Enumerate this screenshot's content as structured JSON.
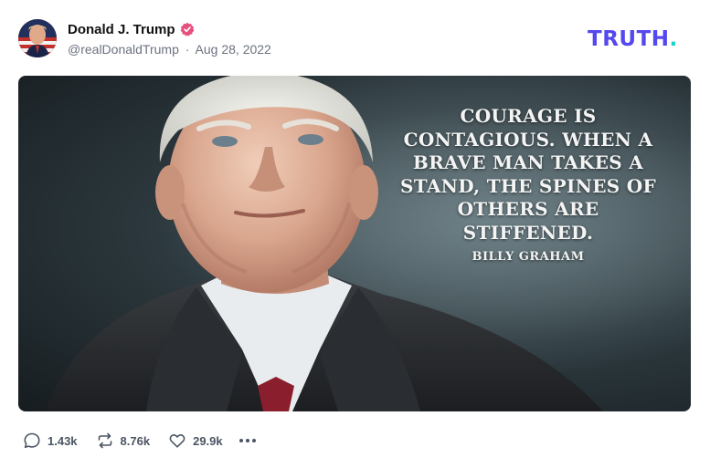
{
  "post": {
    "author_name": "Donald J. Trump",
    "handle": "@realDonaldTrump",
    "separator": "·",
    "date": "Aug 28, 2022",
    "verified_icon": "verified-badge-icon",
    "brand_logo": "TRUTH",
    "brand_period": ".",
    "media": {
      "quote_lines": [
        "Courage is",
        "contagious. When a",
        "brave man takes a",
        "stand, the spines of",
        "others are",
        "stiffened."
      ],
      "attribution": "Billy Graham"
    },
    "actions": {
      "replies": "1.43k",
      "retruths": "8.76k",
      "likes": "29.9k",
      "more_icon": "more-dots-icon"
    }
  },
  "colors": {
    "brand": "#5448ee",
    "brand_accent": "#16d3c4",
    "verified": "#e74f7d",
    "meta_text": "#6b7280"
  }
}
